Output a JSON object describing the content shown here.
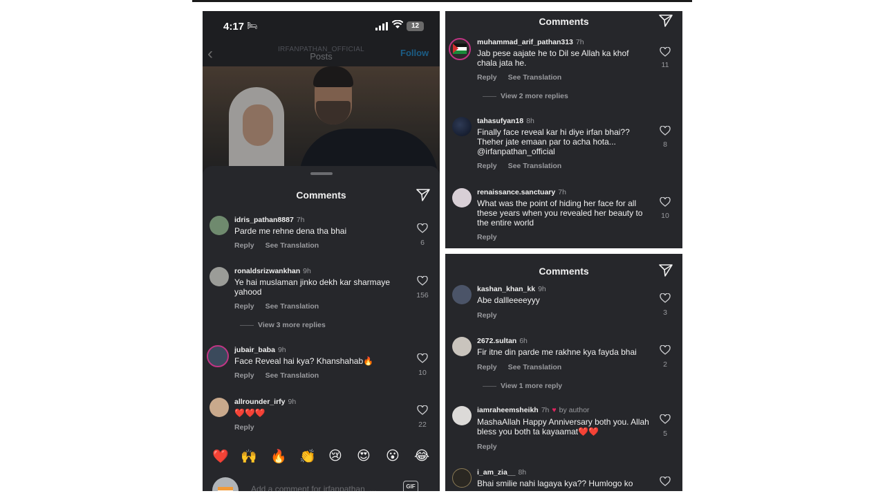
{
  "post_header": {
    "time": "4:17",
    "battery": "12",
    "handle": "IRFANPATHAN_OFFICIAL",
    "title": "Posts",
    "follow": "Follow"
  },
  "panel1": {
    "title": "Comments",
    "comments": [
      {
        "user": "idris_pathan8887",
        "age": "7h",
        "text": "Parde me rehne dena tha bhai",
        "reply": "Reply",
        "translate": "See Translation",
        "likes": "6"
      },
      {
        "user": "ronaldsrizwankhan",
        "age": "9h",
        "text": "Ye hai muslaman jinko dekh kar sharmaye yahood",
        "reply": "Reply",
        "translate": "See Translation",
        "likes": "156",
        "more": "View 3 more replies"
      },
      {
        "user": "jubair_baba",
        "age": "9h",
        "text": "Face Reveal hai kya? Khanshahab🔥",
        "reply": "Reply",
        "translate": "See Translation",
        "likes": "10"
      },
      {
        "user": "allrounder_irfy",
        "age": "9h",
        "text": "❤️❤️❤️",
        "reply": "Reply",
        "likes": "22"
      }
    ],
    "emojis": [
      "❤️",
      "🙌",
      "🔥",
      "👏",
      "😢",
      "😍",
      "😮",
      "😂"
    ],
    "input_placeholder": "Add a comment for irfanpathan_...",
    "gif": "GIF"
  },
  "panel2": {
    "title": "Comments",
    "comments": [
      {
        "user": "muhammad_arif_pathan313",
        "age": "7h",
        "text": "Jab pese aajate he to Dil se  Allah ka khof chala jata he.",
        "reply": "Reply",
        "translate": "See Translation",
        "likes": "11",
        "more": "View 2 more replies"
      },
      {
        "user": "tahasufyan18",
        "age": "8h",
        "text": "Finally face reveal kar hi diye irfan bhai?? Theher jate emaan par to acha hota... @irfanpathan_official",
        "reply": "Reply",
        "translate": "See Translation",
        "likes": "8"
      },
      {
        "user": "renaissance.sanctuary",
        "age": "7h",
        "text": "What was the point of hiding her face for all these years when you revealed her beauty to the entire world",
        "reply": "Reply",
        "likes": "10"
      }
    ]
  },
  "panel3": {
    "title": "Comments",
    "comments": [
      {
        "user": "kashan_khan_kk",
        "age": "9h",
        "text": "Abe dallleeeeyyy",
        "reply": "Reply",
        "likes": "3"
      },
      {
        "user": "2672.sultan",
        "age": "6h",
        "text": "Fir itne din parde me rakhne kya fayda bhai",
        "reply": "Reply",
        "translate": "See Translation",
        "likes": "2",
        "more": "View 1 more reply"
      },
      {
        "user": "iamraheemsheikh",
        "age": "7h",
        "by_author": "by author",
        "text": "MashaAllah Happy Anniversary both you. Allah bless you both ta kayaamat❤️❤️",
        "reply": "Reply",
        "likes": "5"
      },
      {
        "user": "i_am_zia__",
        "age": "8h",
        "text": "Bhai smilie nahi lagaya kya?? Humlogo ko"
      }
    ]
  },
  "colors": {
    "panel_bg": "#26272b",
    "text": "#f1f1f1",
    "muted": "#9a9b9f",
    "follow": "#1b5d86"
  }
}
